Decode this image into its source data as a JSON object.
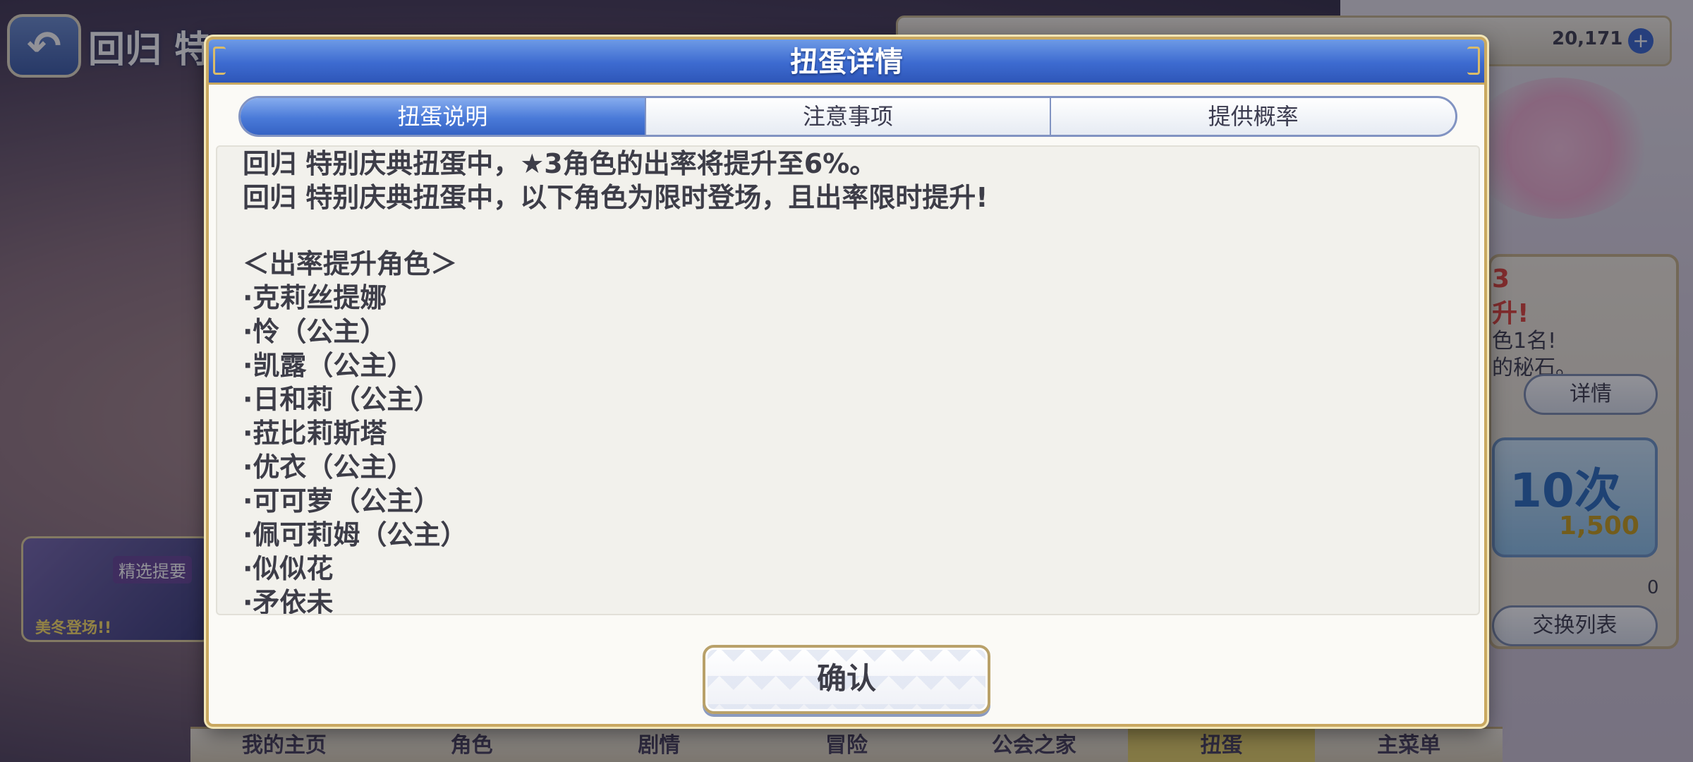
{
  "background": {
    "back_title": "回归 特",
    "gem_count": "20,171",
    "plus_label": "+",
    "right_panel": {
      "red_line_1": "3",
      "red_line_2": "升!",
      "text_1": "色1名!",
      "text_2": "的秘石。",
      "detail_button": "详情",
      "draw_label": "10次",
      "draw_cost": "1,500",
      "stone_count": "0",
      "exchange_button": "交换列表"
    },
    "banner": {
      "tag": "精选提要",
      "caption": "美冬登场!!"
    },
    "bottom_nav": [
      "我的主页",
      "角色",
      "剧情",
      "冒险",
      "公会之家",
      "扭蛋",
      "主菜单"
    ],
    "bottom_nav_active_index": 5
  },
  "dialog": {
    "title": "扭蛋详情",
    "tabs": [
      "扭蛋说明",
      "注意事项",
      "提供概率"
    ],
    "active_tab_index": 0,
    "content_lines": [
      "回归 特别庆典扭蛋中，★3角色的出率将提升至6%。",
      "回归 特别庆典扭蛋中，以下角色为限时登场，且出率限时提升!",
      "",
      "＜出率提升角色＞",
      "·克莉丝提娜",
      "·怜（公主）",
      "·凯露（公主）",
      "·日和莉（公主）",
      "·菈比莉斯塔",
      "·优衣（公主）",
      "·可可萝（公主）",
      "·佩可莉姆（公主）",
      "·似似花",
      "·矛依未"
    ],
    "confirm_label": "确认"
  },
  "colors": {
    "header_blue": "#3d6bd0",
    "border_gold": "#c9a860",
    "text_dark": "#3d3d48"
  }
}
